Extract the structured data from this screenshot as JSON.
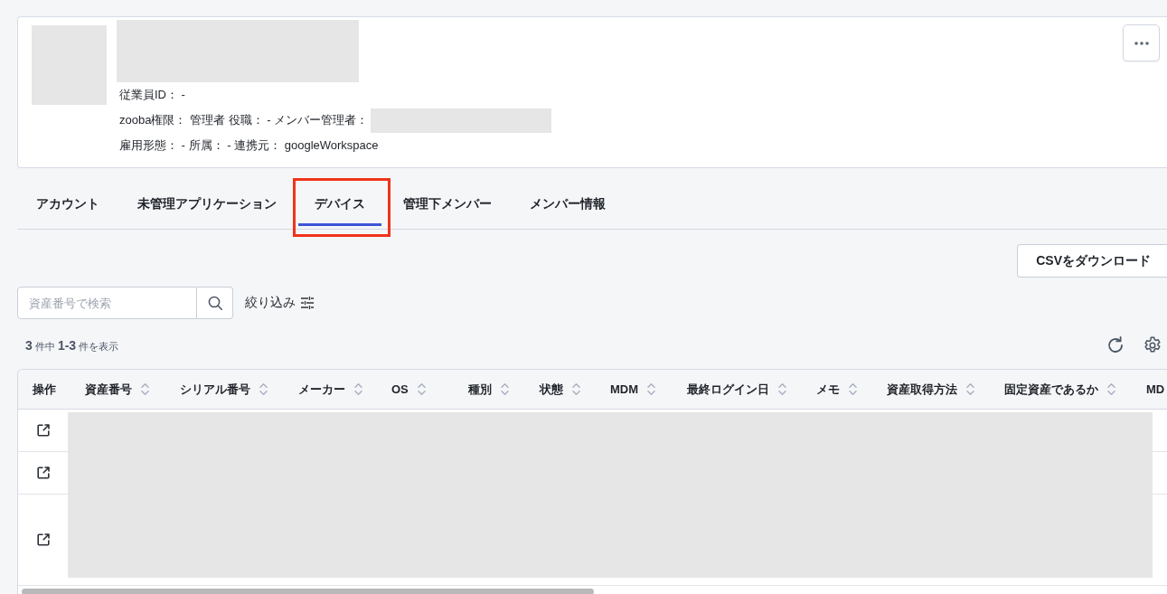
{
  "profile": {
    "name_redacted": true,
    "fields": [
      {
        "text": "従業員ID： -",
        "value_redacted": false
      },
      {
        "text": "zooba権限： 管理者 役職： - メンバー管理者：",
        "value_redacted": true
      },
      {
        "text": "雇用形態： - 所属： - 連携元： googleWorkspace",
        "value_redacted": false
      }
    ]
  },
  "tabs": [
    {
      "label": "アカウント",
      "selected": false,
      "highlighted": false
    },
    {
      "label": "未管理アプリケーション",
      "selected": false,
      "highlighted": false
    },
    {
      "label": "デバイス",
      "selected": true,
      "highlighted": true
    },
    {
      "label": "管理下メンバー",
      "selected": false,
      "highlighted": false
    },
    {
      "label": "メンバー情報",
      "selected": false,
      "highlighted": false
    }
  ],
  "toolbar": {
    "download_button": "CSVをダウンロード",
    "search": {
      "placeholder": "資産番号で検索"
    },
    "filter_button": "絞り込み"
  },
  "result_count": "**3** 件中 **1-3** 件を表示",
  "table": {
    "columns": [
      {
        "label": "操作",
        "sortable": false
      },
      {
        "label": "資産番号",
        "sortable": true
      },
      {
        "label": "シリアル番号",
        "sortable": true
      },
      {
        "label": "メーカー",
        "sortable": true
      },
      {
        "label": "OS",
        "sortable": true
      },
      {
        "label": "種別",
        "sortable": true
      },
      {
        "label": "状態",
        "sortable": true
      },
      {
        "label": "MDM",
        "sortable": true
      },
      {
        "label": "最終ログイン日",
        "sortable": true
      },
      {
        "label": "メモ",
        "sortable": true
      },
      {
        "label": "資産取得方法",
        "sortable": true
      },
      {
        "label": "固定資産であるか",
        "sortable": true
      },
      {
        "label": "MD"
      }
    ],
    "redacted": true,
    "rows": [
      {
        "kind": "short"
      },
      {
        "kind": "short"
      },
      {
        "kind": "tall"
      }
    ]
  }
}
